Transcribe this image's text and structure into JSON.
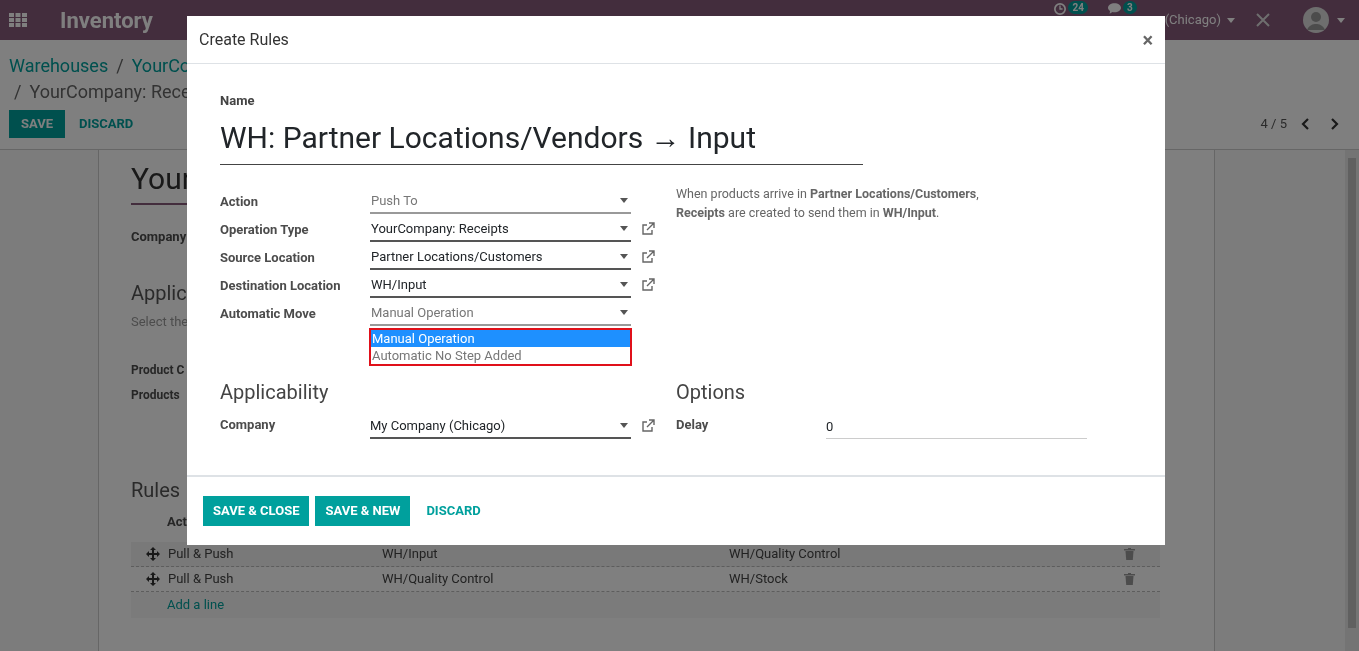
{
  "navbar": {
    "app_title": "Inventory",
    "activity_count": "24",
    "message_count": "3",
    "company": "(Chicago)"
  },
  "breadcrumb": {
    "separator": "/",
    "items": [
      "Warehouses",
      "YourCo",
      "YourCompany: Rece"
    ]
  },
  "form_buttons": [
    {
      "label": "SAVE",
      "kind": "primary"
    },
    {
      "label": "DISCARD",
      "kind": "link"
    }
  ],
  "pager": "4 / 5",
  "sheet": {
    "title": "Your",
    "company_label": "Company",
    "section_title": "Applic",
    "section_hint": "Select the",
    "product_labels": [
      "Product C",
      "Products"
    ],
    "rules_title": "Rules",
    "rules_header": "Act",
    "rules": [
      {
        "action": "Pull & Push",
        "source": "WH/Input",
        "destination": "WH/Quality Control"
      },
      {
        "action": "Pull & Push",
        "source": "WH/Quality Control",
        "destination": "WH/Stock"
      }
    ],
    "add_line": "Add a line"
  },
  "dialog": {
    "title": "Create Rules",
    "close": "×",
    "name_label": "Name",
    "name": "WH: Partner Locations/Vendors → Input",
    "fields": [
      {
        "label": "Action",
        "value": "Push To",
        "kind": "selection"
      },
      {
        "label": "Operation Type",
        "value": "YourCompany: Receipts",
        "kind": "many2one"
      },
      {
        "label": "Source Location",
        "value": "Partner Locations/Customers",
        "kind": "many2one"
      },
      {
        "label": "Destination Location",
        "value": "WH/Input",
        "kind": "many2one"
      },
      {
        "label": "Automatic Move",
        "value": "Manual Operation",
        "kind": "selection",
        "options": [
          {
            "label": "Manual Operation",
            "selected": true
          },
          {
            "label": "Automatic No Step Added",
            "selected": false
          }
        ]
      }
    ],
    "help_text": "When products arrive in **Partner Locations/Customers**, **Receipts** are created to send them in **WH/Input**.",
    "applicability": {
      "title": "Applicability",
      "company_label": "Company",
      "company": "My Company (Chicago)"
    },
    "options": {
      "title": "Options",
      "delay_label": "Delay",
      "delay": "0"
    },
    "buttons": [
      {
        "label": "SAVE & CLOSE",
        "kind": "primary"
      },
      {
        "label": "SAVE & NEW",
        "kind": "primary"
      },
      {
        "label": "DISCARD",
        "kind": "link"
      }
    ]
  }
}
